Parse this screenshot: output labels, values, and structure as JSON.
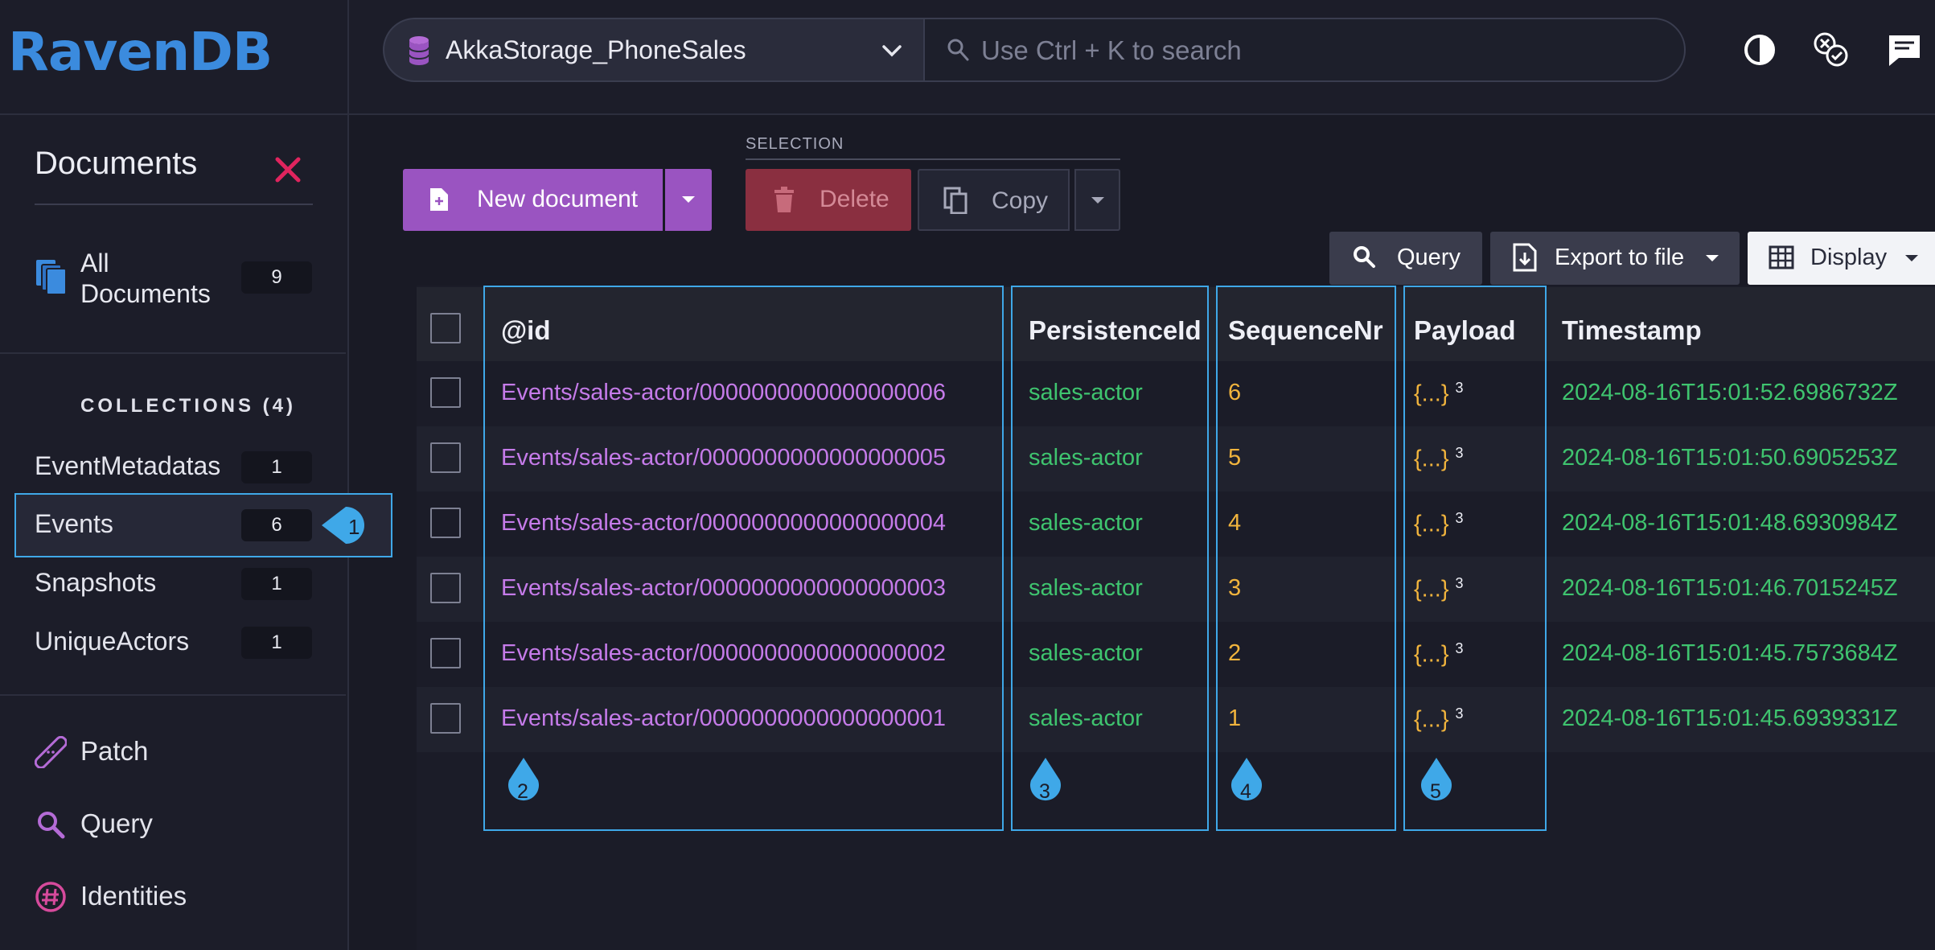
{
  "app": {
    "logo_text": "RavenDB"
  },
  "topbar": {
    "database": "AkkaStorage_PhoneSales",
    "search_placeholder": "Use Ctrl + K to search"
  },
  "sidebar": {
    "title": "Documents",
    "all_documents": {
      "label": "All Documents",
      "count": "9"
    },
    "collections_header": "COLLECTIONS (4)",
    "collections": [
      {
        "label": "EventMetadatas",
        "count": "1"
      },
      {
        "label": "Events",
        "count": "6",
        "active": true
      },
      {
        "label": "Snapshots",
        "count": "1"
      },
      {
        "label": "UniqueActors",
        "count": "1"
      }
    ],
    "menu": [
      {
        "label": "Patch",
        "icon": "patch-icon"
      },
      {
        "label": "Query",
        "icon": "query-icon"
      },
      {
        "label": "Identities",
        "icon": "identities-icon"
      }
    ]
  },
  "toolbar": {
    "new_document": "New document",
    "selection_label": "SELECTION",
    "delete": "Delete",
    "copy": "Copy",
    "query": "Query",
    "export": "Export to file",
    "display": "Display"
  },
  "grid": {
    "columns": [
      "@id",
      "PersistenceId",
      "SequenceNr",
      "Payload",
      "Timestamp"
    ],
    "rows": [
      {
        "id": "Events/sales-actor/0000000000000000006",
        "persistence_id": "sales-actor",
        "seq": "6",
        "payload": "{...}",
        "payload_count": "3",
        "timestamp": "2024-08-16T15:01:52.6986732Z"
      },
      {
        "id": "Events/sales-actor/0000000000000000005",
        "persistence_id": "sales-actor",
        "seq": "5",
        "payload": "{...}",
        "payload_count": "3",
        "timestamp": "2024-08-16T15:01:50.6905253Z"
      },
      {
        "id": "Events/sales-actor/0000000000000000004",
        "persistence_id": "sales-actor",
        "seq": "4",
        "payload": "{...}",
        "payload_count": "3",
        "timestamp": "2024-08-16T15:01:48.6930984Z"
      },
      {
        "id": "Events/sales-actor/0000000000000000003",
        "persistence_id": "sales-actor",
        "seq": "3",
        "payload": "{...}",
        "payload_count": "3",
        "timestamp": "2024-08-16T15:01:46.7015245Z"
      },
      {
        "id": "Events/sales-actor/0000000000000000002",
        "persistence_id": "sales-actor",
        "seq": "2",
        "payload": "{...}",
        "payload_count": "3",
        "timestamp": "2024-08-16T15:01:45.7573684Z"
      },
      {
        "id": "Events/sales-actor/0000000000000000001",
        "persistence_id": "sales-actor",
        "seq": "1",
        "payload": "{...}",
        "payload_count": "3",
        "timestamp": "2024-08-16T15:01:45.6939331Z"
      }
    ]
  },
  "annotations": {
    "badge_1": "1",
    "badge_2": "2",
    "badge_3": "3",
    "badge_4": "4",
    "badge_5": "5"
  },
  "colors": {
    "accent_purple": "#9a54c1",
    "highlight_blue": "#3fa8e8",
    "id_purple": "#c57be9",
    "value_green": "#3fc46f",
    "number_orange": "#f1b43d",
    "delete_red": "#8a2f40"
  }
}
